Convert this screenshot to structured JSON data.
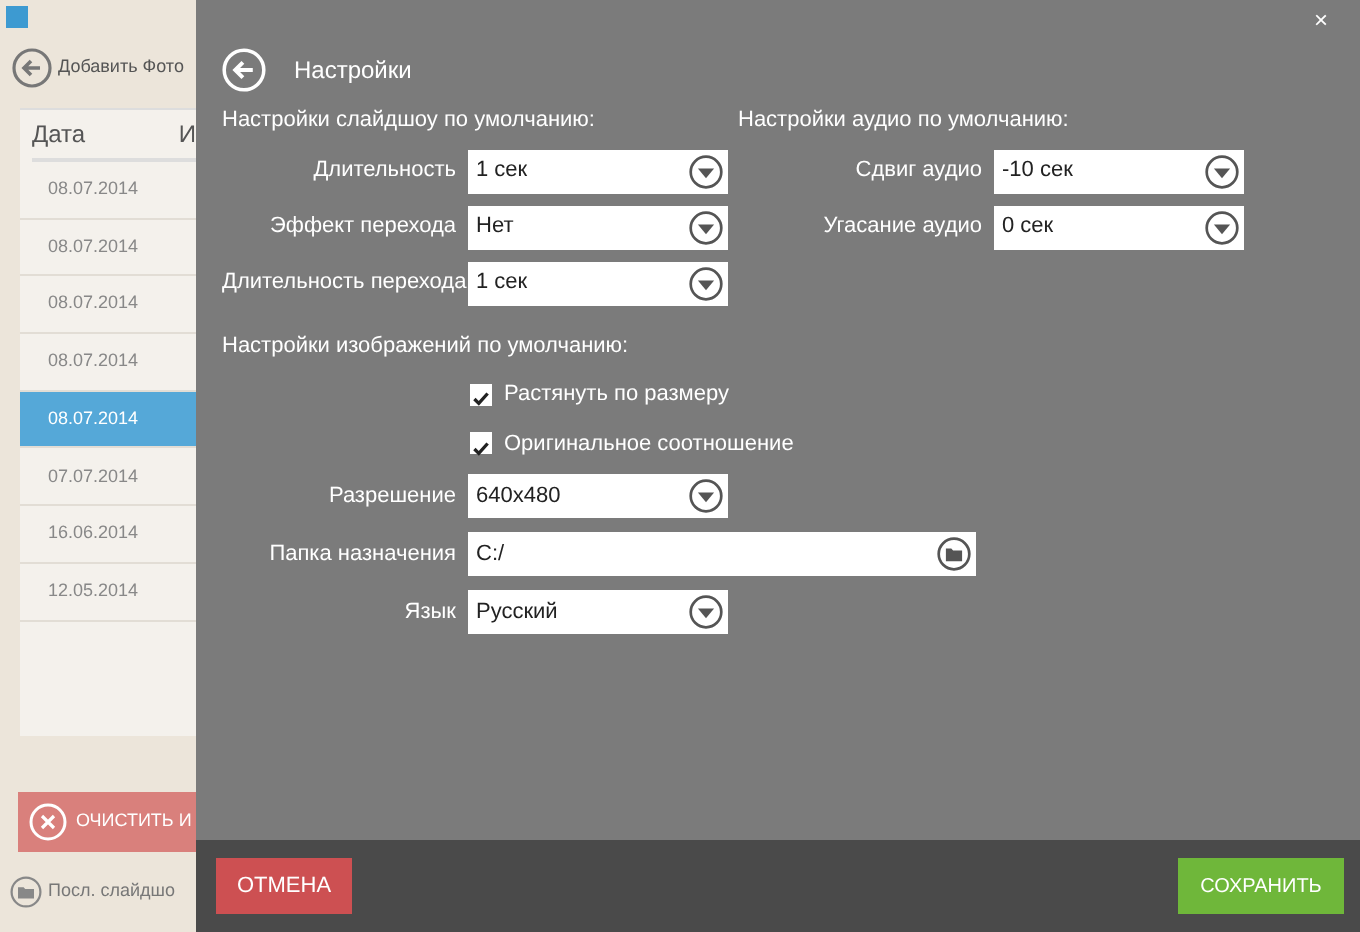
{
  "background_app": {
    "add_photo": "Добавить Фото",
    "table": {
      "columns": [
        "Дата",
        "И"
      ],
      "rows": [
        {
          "date": "08.07.2014",
          "selected": false
        },
        {
          "date": "08.07.2014",
          "selected": false
        },
        {
          "date": "08.07.2014",
          "selected": false
        },
        {
          "date": "08.07.2014",
          "selected": false
        },
        {
          "date": "08.07.2014",
          "selected": true
        },
        {
          "date": "07.07.2014",
          "selected": false
        },
        {
          "date": "16.06.2014",
          "selected": false
        },
        {
          "date": "12.05.2014",
          "selected": false
        }
      ]
    },
    "clear_button": "ОЧИСТИТЬ И",
    "last_slideshow": "Посл. слайдшо"
  },
  "dialog": {
    "close": "×",
    "title": "Настройки",
    "slideshow": {
      "heading": "Настройки слайдшоу по умолчанию:",
      "fields": [
        {
          "label": "Длительность",
          "value": "1 сек"
        },
        {
          "label": "Эффект перехода",
          "value": "Нет"
        },
        {
          "label": "Длительность перехода",
          "value": "1 сек"
        }
      ]
    },
    "audio": {
      "heading": "Настройки аудио по умолчанию:",
      "fields": [
        {
          "label": "Сдвиг аудио",
          "value": "-10 сек"
        },
        {
          "label": "Угасание аудио",
          "value": "0 сек"
        }
      ]
    },
    "images": {
      "heading": "Настройки изображений по умолчанию:",
      "checkboxes": [
        {
          "label": "Растянуть по размеру",
          "checked": true
        },
        {
          "label": "Оригинальное соотношение",
          "checked": true
        }
      ],
      "fields": [
        {
          "kind": "select",
          "label": "Разрешение",
          "value": "640x480"
        },
        {
          "kind": "folder",
          "label": "Папка назначения",
          "value": "C:/"
        },
        {
          "kind": "select",
          "label": "Язык",
          "value": "Русский"
        }
      ]
    },
    "cancel": "ОТМЕНА",
    "save": "СОХРАНИТЬ"
  }
}
